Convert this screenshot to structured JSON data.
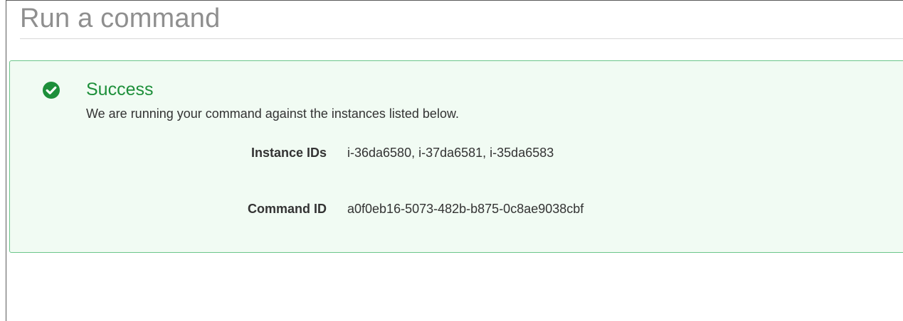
{
  "page": {
    "title": "Run a command"
  },
  "alert": {
    "status": "success",
    "icon": "check-circle-icon",
    "heading": "Success",
    "message": "We are running your command against the instances listed below.",
    "colors": {
      "heading": "#1d8f3a",
      "icon": "#1d8f3a",
      "border": "#6cc58a",
      "background": "#f1fbf3"
    },
    "fields": {
      "instance_ids": {
        "label": "Instance IDs",
        "value": "i-36da6580, i-37da6581, i-35da6583"
      },
      "command_id": {
        "label": "Command ID",
        "value": "a0f0eb16-5073-482b-b875-0c8ae9038cbf"
      }
    }
  }
}
